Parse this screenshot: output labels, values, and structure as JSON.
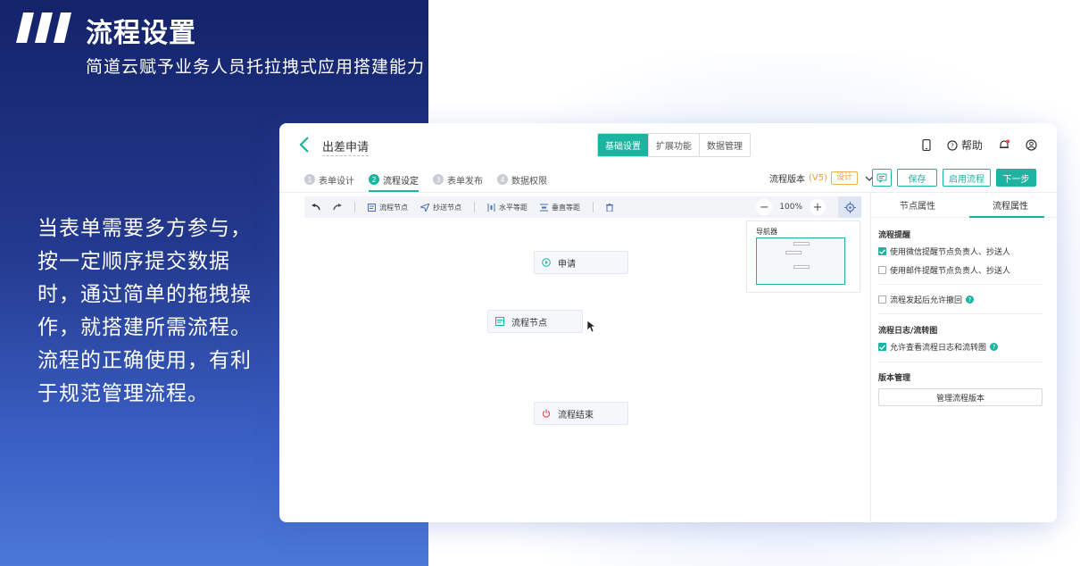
{
  "slide": {
    "title": "流程设置",
    "subtitle": "简道云赋予业务人员托拉拽式应用搭建能力",
    "body": "当表单需要多方参与，按一定顺序提交数据时，通过简单的拖拽操作，就搭建所需流程。流程的正确使用，有利于规范管理流程。"
  },
  "app": {
    "form_name": "出差申请",
    "top_tabs": [
      "基础设置",
      "扩展功能",
      "数据管理"
    ],
    "active_top_tab": "基础设置",
    "help_label": "帮助",
    "steps": [
      {
        "num": "1",
        "label": "表单设计"
      },
      {
        "num": "2",
        "label": "流程设定"
      },
      {
        "num": "3",
        "label": "表单发布"
      },
      {
        "num": "4",
        "label": "数据权限"
      }
    ],
    "version_label": "流程版本",
    "version_value": "(V5)",
    "design_badge": "设计",
    "buttons": {
      "save": "保存",
      "enable": "启用流程",
      "next": "下一步"
    },
    "toolbar": {
      "process_node": "流程节点",
      "cc_node": "抄送节点",
      "h_equal": "水平等距",
      "v_equal": "垂直等距",
      "zoom_level": "100%"
    },
    "nodes": {
      "apply": "申请",
      "process": "流程节点",
      "end": "流程结束"
    },
    "navigator_title": "导航器",
    "panel": {
      "tabs": [
        "节点属性",
        "流程属性"
      ],
      "active_tab": "流程属性",
      "reminder_heading": "流程提醒",
      "wechat_reminder": "使用微信提醒节点负责人、抄送人",
      "mail_reminder": "使用邮件提醒节点负责人、抄送人",
      "allow_withdraw": "流程发起后允许撤回",
      "log_heading": "流程日志/流转图",
      "allow_log": "允许查看流程日志和流转图",
      "version_heading": "版本管理",
      "manage_versions": "管理流程版本"
    }
  },
  "colors": {
    "accent": "#1cb3a0",
    "warn": "#f0a030",
    "slide_dark": "#14236a",
    "slide_light": "#4b78d6"
  }
}
